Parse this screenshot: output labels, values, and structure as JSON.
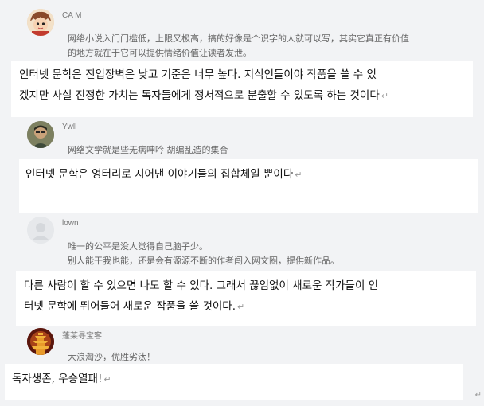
{
  "comments": [
    {
      "username": "CA M",
      "avatar_icon": "cartoon-character-avatar",
      "body_lines": [
        "网络小说入门门槛低，上限又极高，搞的好像是个识字的人就可以写，其实它真正有价值",
        "的地方就在于它可以提供情绪价值让读者发泄。"
      ],
      "translation_lines": [
        "인터넷 문학은 진입장벽은 낮고 기준은 너무 높다. 지식인들이야 작품을 쓸 수 있",
        "겠지만 사실 진정한 가치는 독자들에게 정서적으로 분출할 수 있도록 하는 것이다"
      ]
    },
    {
      "username": "Ywll",
      "avatar_icon": "person-photo-avatar",
      "body_lines": [
        "网络文学就是些无病呻吟 胡编乱造的集合"
      ],
      "translation_lines": [
        "인터넷 문학은 엉터리로 지어낸 이야기들의 집합체일 뿐이다"
      ]
    },
    {
      "username": "lown",
      "avatar_icon": "default-user-avatar",
      "body_lines": [
        "唯一的公平是没人觉得自己脑子少。",
        "别人能干我也能，还是会有源源不断的作者闯入网文圈，提供新作品。"
      ],
      "translation_lines": [
        "다른 사람이 할 수 있으면 나도 할 수 있다. 그래서 끊임없이 새로운 작가들이 인",
        "터넷 문학에 뛰어들어 새로운 작품을 쓸 것이다."
      ]
    },
    {
      "username": "蓬莱寻宝客",
      "avatar_icon": "pagoda-tower-avatar",
      "body_lines": [
        "大浪淘沙，优胜劣汰！"
      ],
      "translation_lines": [
        "독자생존, 우승열패!"
      ]
    }
  ],
  "paragraph_mark": "↵"
}
